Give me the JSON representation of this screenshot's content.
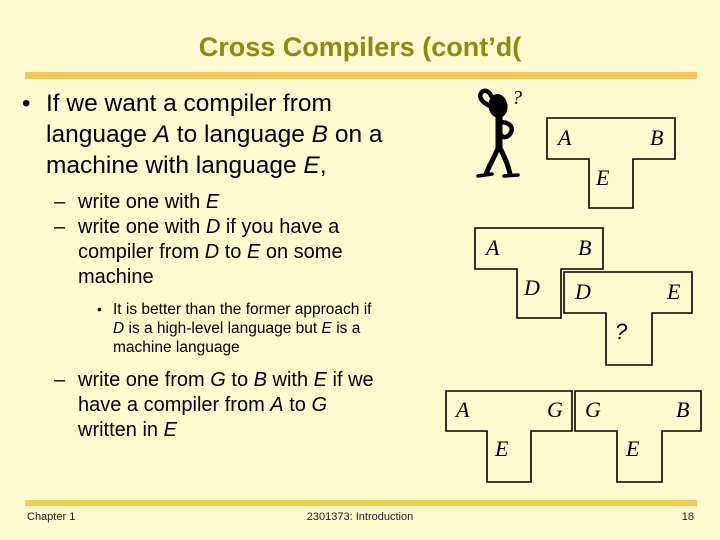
{
  "slide": {
    "title": "Cross Compilers (cont’d(",
    "background_color": "#FCFBCF",
    "title_color": "#8A8B11",
    "rule_color": "#F7C95C"
  },
  "content": {
    "bullet1": {
      "marker": "•",
      "line1_a": "If we want a compiler from",
      "line2_a": "language ",
      "line2_i1": "A",
      "line2_b": " to language ",
      "line2_i2": "B",
      "line2_c": " on a",
      "line3_a": "machine with language ",
      "line3_i1": "E",
      "line3_b": ","
    },
    "sub1": {
      "marker": "–",
      "text_a": "write one with ",
      "text_i1": "E"
    },
    "sub2": {
      "marker": "–",
      "line1_a": "write one with ",
      "line1_i1": "D",
      "line1_b": " if you have a",
      "line2_a": "compiler from ",
      "line2_i1": "D",
      "line2_b": " to ",
      "line2_i2": "E",
      "line2_c": " on some",
      "line3_a": "machine"
    },
    "sub2_note": {
      "marker": "•",
      "line1_a": "It is better than the former approach if",
      "line2_i1": "D",
      "line2_a": " is a high-level language but ",
      "line2_i2": "E",
      "line2_b": " is a",
      "line3_a": "machine language"
    },
    "sub3": {
      "marker": "–",
      "line1_a": "write one from ",
      "line1_i1": "G",
      "line1_b": " to ",
      "line1_i2": "B",
      "line1_c": " with ",
      "line1_i3": "E",
      "line1_d": " if we",
      "line2_a": "have a compiler from ",
      "line2_i1": "A",
      "line2_b": " to ",
      "line2_i2": "G",
      "line3_a": "written in ",
      "line3_i1": "E"
    }
  },
  "diagrams": {
    "group1": {
      "t1": {
        "left_label": "A",
        "right_label": "B",
        "stem_label": "E"
      }
    },
    "group2": {
      "t1": {
        "left_label": "A",
        "right_label": "B",
        "stem_label": "D"
      },
      "t2": {
        "left_label": "D",
        "right_label": "E",
        "stem_label": "?"
      }
    },
    "group3": {
      "t1": {
        "left_label": "A",
        "right_label": "G",
        "stem_label": "E"
      },
      "t2": {
        "left_label": "G",
        "right_label": "B",
        "stem_label": "E"
      }
    },
    "clipart": {
      "name": "thinking-stick-figure",
      "symbol": "?"
    }
  },
  "footer": {
    "left": "Chapter 1",
    "center": "2301373: Introduction",
    "right": "18"
  }
}
